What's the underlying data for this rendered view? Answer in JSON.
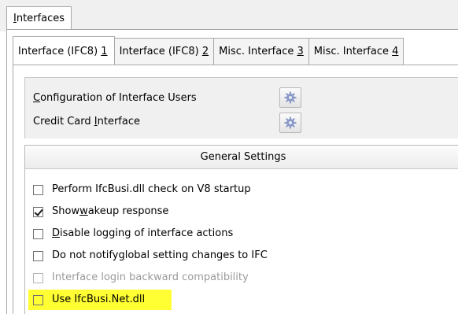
{
  "outer_tab": {
    "prefix": "I",
    "rest": "nterfaces"
  },
  "inner_tabs": [
    {
      "label": "Interface (IFC8) ",
      "num": "1"
    },
    {
      "label": "Interface (IFC8) ",
      "num": "2"
    },
    {
      "label": "Misc. Interface ",
      "num": "3"
    },
    {
      "label": "Misc. Interface ",
      "num": "4"
    }
  ],
  "config": {
    "row1": {
      "a": "C",
      "b": "onfiguration of Interface Users"
    },
    "row2": {
      "a": "Credit Card ",
      "b": "I",
      "c": "nterface"
    },
    "button_icon": "gear-icon"
  },
  "general": {
    "title": "General Settings",
    "opt1": {
      "label": "Perform IfcBusi.dll check on V8 startup",
      "checked": false
    },
    "opt2": {
      "a": "Show ",
      "b": "w",
      "c": "akeup response",
      "checked": true
    },
    "opt3": {
      "a": "D",
      "b": "isable logging of interface actions",
      "checked": false
    },
    "opt4": {
      "a": "Do not notify ",
      "b": "g",
      "c": "lobal setting changes to IFC",
      "checked": false
    },
    "opt5": {
      "label": "Interface login backward compatibility",
      "checked": false,
      "disabled": true
    },
    "opt6": {
      "label": "Use IfcBusi.Net.dll",
      "checked": false,
      "highlighted": true
    }
  },
  "colors": {
    "highlight": "#ffff33",
    "panel_bg": "#f0f0f0",
    "border": "#a8a8a8"
  }
}
